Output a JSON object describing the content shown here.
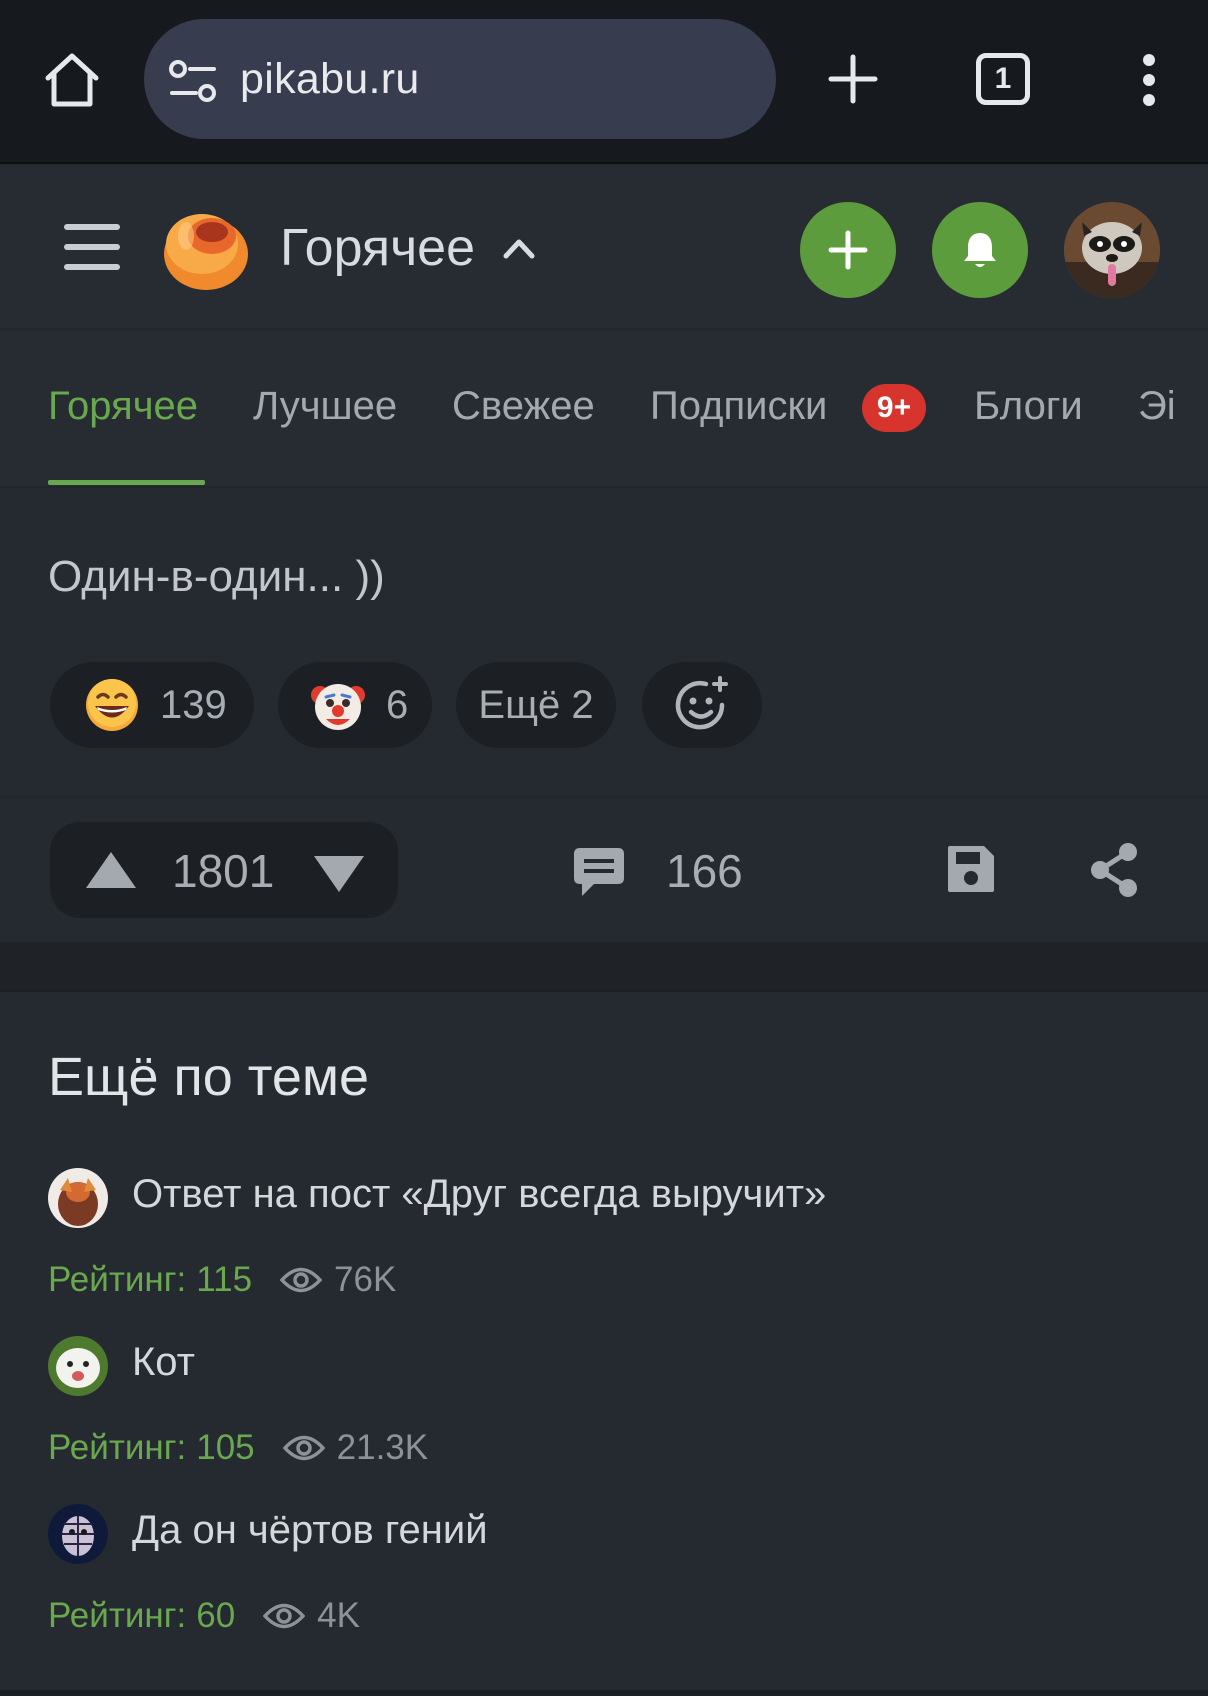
{
  "browser": {
    "url": "pikabu.ru",
    "tab_count": "1",
    "icons": [
      "home-icon",
      "site-settings-icon",
      "new-tab-icon",
      "tabs-icon",
      "more-menu-icon"
    ]
  },
  "header": {
    "title": "Горячее",
    "icons": [
      "hamburger-icon",
      "pikabu-logo",
      "caret-up-icon",
      "add-post-icon",
      "bell-icon",
      "avatar"
    ]
  },
  "tabs": [
    {
      "label": "Горячее",
      "active": true
    },
    {
      "label": "Лучшее",
      "active": false
    },
    {
      "label": "Свежее",
      "active": false
    },
    {
      "label": "Подписки",
      "active": false,
      "badge": "9+"
    },
    {
      "label": "Блоги",
      "active": false
    },
    {
      "label": "Эі",
      "active": false
    }
  ],
  "post": {
    "text": "Один-в-один... ))",
    "reactions": [
      {
        "emoji": "grinning-face",
        "count": "139"
      },
      {
        "emoji": "clown-face",
        "count": "6"
      },
      {
        "label": "Ещё 2"
      },
      {
        "emoji": "add-reaction"
      }
    ],
    "rating": "1801",
    "comments": "166"
  },
  "related": {
    "heading": "Ещё по теме",
    "items": [
      {
        "title": "Ответ на пост «Друг всегда выручит»",
        "rating_label": "Рейтинг:",
        "rating": "115",
        "views": "76K"
      },
      {
        "title": "Кот",
        "rating_label": "Рейтинг:",
        "rating": "105",
        "views": "21.3K"
      },
      {
        "title": "Да он чёртов гений",
        "rating_label": "Рейтинг:",
        "rating": "60",
        "views": "4K"
      }
    ]
  },
  "colors": {
    "accent_green": "#6aa84f",
    "button_green": "#5d9c3c",
    "badge_red": "#d6342c",
    "background": "#252a30",
    "browser_bar": "#16191d",
    "url_pill": "#373c4e"
  }
}
